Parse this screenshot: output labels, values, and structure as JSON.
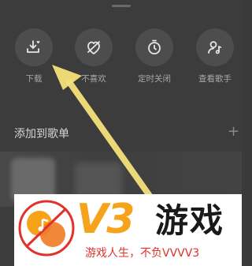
{
  "actions": [
    {
      "label": "下载",
      "icon": "download-icon"
    },
    {
      "label": "不喜欢",
      "icon": "dislike-heart-icon"
    },
    {
      "label": "定时关闭",
      "icon": "timer-icon"
    },
    {
      "label": "查看歌手",
      "icon": "singer-icon"
    }
  ],
  "playlist_section": {
    "title": "添加到歌单",
    "add_icon": "plus-icon"
  },
  "watermark": {
    "brand": "V3",
    "name": "游戏",
    "slogan": "游戏人生，不负VVVV3"
  },
  "colors": {
    "arrow": "#f4e07a",
    "brand_orange": "#f6a21a",
    "slogan_red": "#e0322b",
    "sheet_bg": "#3c3c3c"
  }
}
